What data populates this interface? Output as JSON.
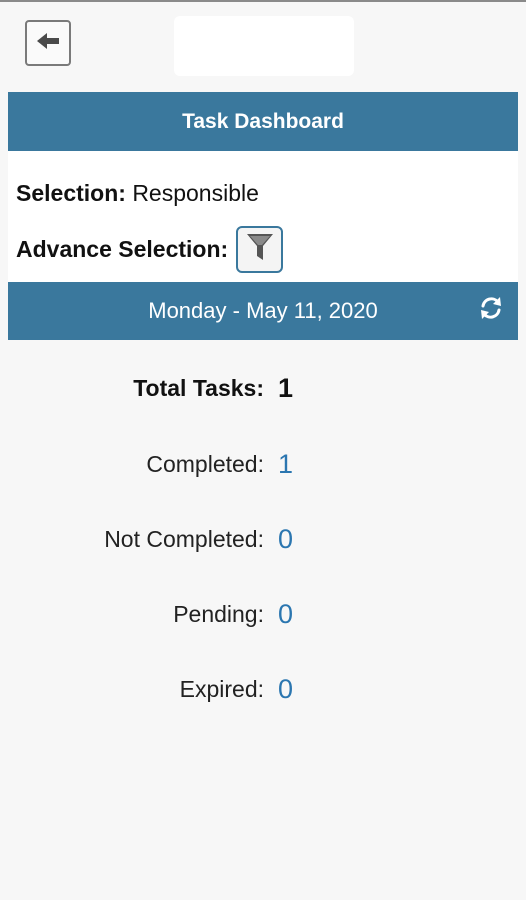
{
  "header": {
    "back_icon": "arrow-left-icon"
  },
  "dashboard": {
    "title": "Task Dashboard"
  },
  "selection": {
    "label": "Selection:",
    "value": "Responsible",
    "advance_label": "Advance Selection:",
    "filter_icon": "funnel-icon"
  },
  "date_bar": {
    "date": "Monday - May 11, 2020",
    "refresh_icon": "refresh-icon"
  },
  "stats": {
    "total": {
      "label": "Total Tasks:",
      "value": "1"
    },
    "completed": {
      "label": "Completed:",
      "value": "1"
    },
    "not_completed": {
      "label": "Not Completed:",
      "value": "0"
    },
    "pending": {
      "label": "Pending:",
      "value": "0"
    },
    "expired": {
      "label": "Expired:",
      "value": "0"
    }
  },
  "colors": {
    "accent": "#3a789d",
    "value_blue": "#2b76b0",
    "background": "#f7f7f7"
  }
}
